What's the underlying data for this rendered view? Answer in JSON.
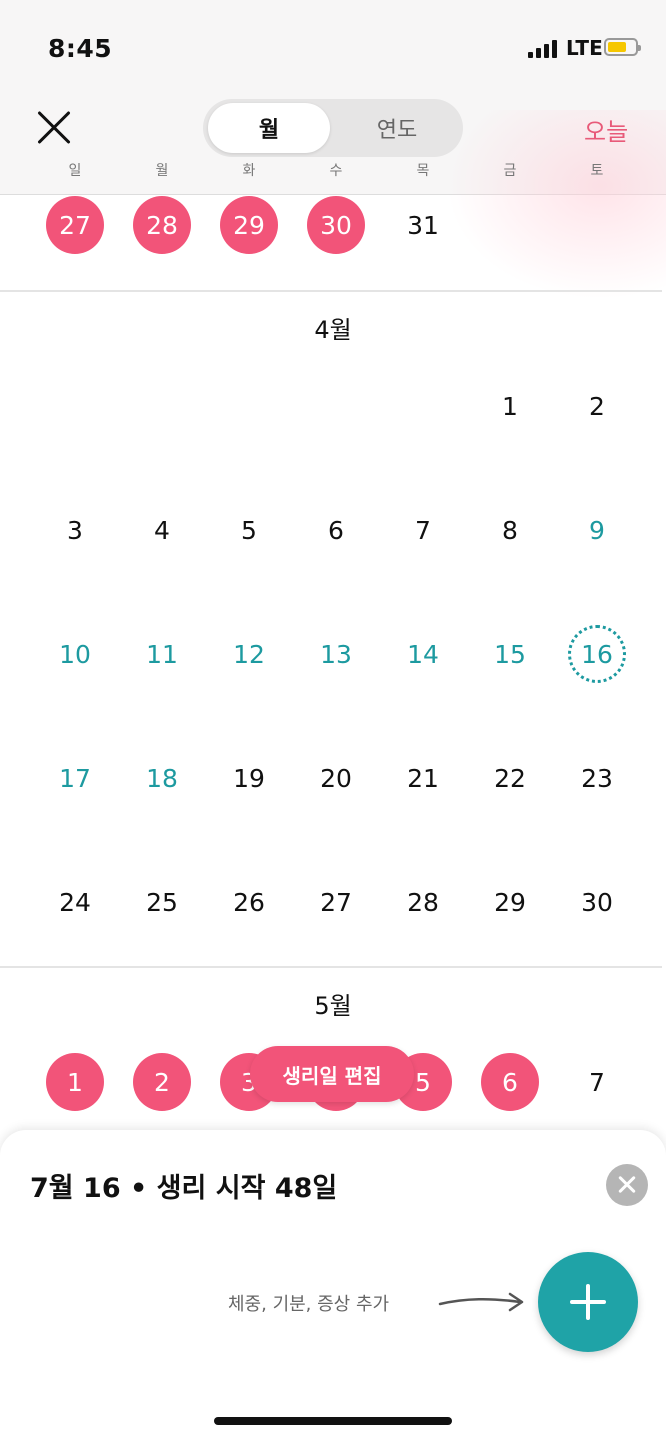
{
  "status_bar": {
    "time": "8:45",
    "network": "LTE"
  },
  "header": {
    "segments": {
      "month": "월",
      "year": "연도"
    },
    "today_label": "오늘",
    "weekdays": [
      "일",
      "월",
      "화",
      "수",
      "목",
      "금",
      "토"
    ]
  },
  "calendar": {
    "march_tail": [
      {
        "d": "27",
        "state": "period"
      },
      {
        "d": "28",
        "state": "period"
      },
      {
        "d": "29",
        "state": "period"
      },
      {
        "d": "30",
        "state": "period"
      },
      {
        "d": "31",
        "state": "normal"
      }
    ],
    "april": {
      "title": "4월",
      "weeks": [
        [
          null,
          null,
          null,
          null,
          null,
          {
            "d": "1",
            "state": "normal"
          },
          {
            "d": "2",
            "state": "normal"
          }
        ],
        [
          {
            "d": "3",
            "state": "normal"
          },
          {
            "d": "4",
            "state": "normal"
          },
          {
            "d": "5",
            "state": "normal"
          },
          {
            "d": "6",
            "state": "normal"
          },
          {
            "d": "7",
            "state": "normal"
          },
          {
            "d": "8",
            "state": "normal"
          },
          {
            "d": "9",
            "state": "fertile"
          }
        ],
        [
          {
            "d": "10",
            "state": "fertile"
          },
          {
            "d": "11",
            "state": "fertile"
          },
          {
            "d": "12",
            "state": "fertile"
          },
          {
            "d": "13",
            "state": "fertile"
          },
          {
            "d": "14",
            "state": "fertile"
          },
          {
            "d": "15",
            "state": "fertile"
          },
          {
            "d": "16",
            "state": "today"
          }
        ],
        [
          {
            "d": "17",
            "state": "fertile"
          },
          {
            "d": "18",
            "state": "fertile"
          },
          {
            "d": "19",
            "state": "normal"
          },
          {
            "d": "20",
            "state": "normal"
          },
          {
            "d": "21",
            "state": "normal"
          },
          {
            "d": "22",
            "state": "normal"
          },
          {
            "d": "23",
            "state": "normal"
          }
        ],
        [
          {
            "d": "24",
            "state": "normal"
          },
          {
            "d": "25",
            "state": "normal"
          },
          {
            "d": "26",
            "state": "normal"
          },
          {
            "d": "27",
            "state": "normal"
          },
          {
            "d": "28",
            "state": "normal"
          },
          {
            "d": "29",
            "state": "normal"
          },
          {
            "d": "30",
            "state": "normal"
          }
        ]
      ]
    },
    "may": {
      "title": "5월",
      "first_week": [
        {
          "d": "1",
          "state": "period"
        },
        {
          "d": "2",
          "state": "period"
        },
        {
          "d": "3",
          "state": "period"
        },
        {
          "d": "4",
          "state": "period"
        },
        {
          "d": "5",
          "state": "period"
        },
        {
          "d": "6",
          "state": "period"
        },
        {
          "d": "7",
          "state": "normal"
        }
      ]
    }
  },
  "edit_button": "생리일 편집",
  "sheet": {
    "title": "7월 16 • 생리 시작 48일",
    "hint": "체중, 기분, 증상 추가"
  },
  "colors": {
    "period": "#f25479",
    "fertile": "#1d9aa0",
    "accent": "#1fa3a7",
    "today_link": "#e85a79"
  }
}
